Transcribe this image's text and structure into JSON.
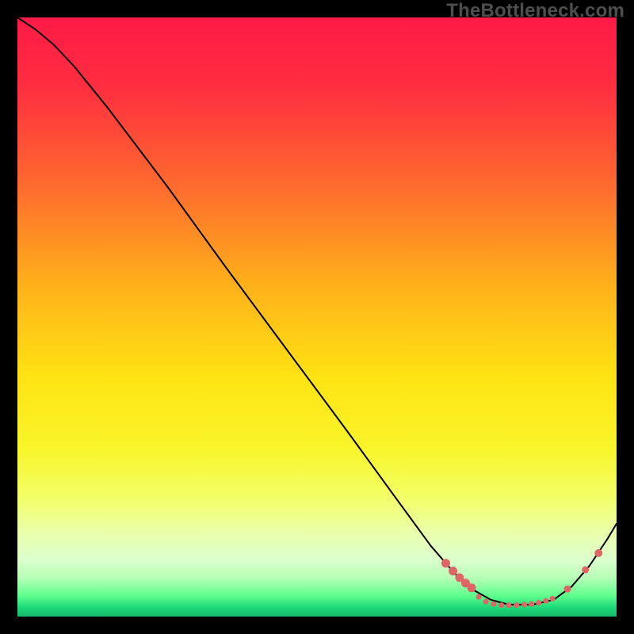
{
  "watermark": "TheBottleneck.com",
  "chart_data": {
    "type": "line",
    "title": "",
    "xlabel": "",
    "ylabel": "",
    "xlim": [
      0,
      1
    ],
    "ylim": [
      0,
      1
    ],
    "gradient_stops": [
      {
        "offset": 0.0,
        "color": "#ff1a47"
      },
      {
        "offset": 0.12,
        "color": "#ff2f40"
      },
      {
        "offset": 0.28,
        "color": "#ff6a2e"
      },
      {
        "offset": 0.45,
        "color": "#ffb21a"
      },
      {
        "offset": 0.6,
        "color": "#ffe313"
      },
      {
        "offset": 0.72,
        "color": "#f8f52a"
      },
      {
        "offset": 0.8,
        "color": "#f3ff66"
      },
      {
        "offset": 0.86,
        "color": "#eaffab"
      },
      {
        "offset": 0.905,
        "color": "#dcffce"
      },
      {
        "offset": 0.935,
        "color": "#b7ffb7"
      },
      {
        "offset": 0.965,
        "color": "#5fff8d"
      },
      {
        "offset": 0.985,
        "color": "#1dd97a"
      },
      {
        "offset": 1.0,
        "color": "#16b96b"
      }
    ],
    "series": [
      {
        "name": "curve",
        "stroke": "#000000",
        "stroke_width": 2,
        "points": [
          {
            "x": 0.0,
            "y": 1.0
          },
          {
            "x": 0.03,
            "y": 0.98
          },
          {
            "x": 0.06,
            "y": 0.955
          },
          {
            "x": 0.095,
            "y": 0.918
          },
          {
            "x": 0.15,
            "y": 0.85
          },
          {
            "x": 0.25,
            "y": 0.718
          },
          {
            "x": 0.35,
            "y": 0.58
          },
          {
            "x": 0.45,
            "y": 0.445
          },
          {
            "x": 0.55,
            "y": 0.31
          },
          {
            "x": 0.63,
            "y": 0.2
          },
          {
            "x": 0.69,
            "y": 0.118
          },
          {
            "x": 0.73,
            "y": 0.072
          },
          {
            "x": 0.76,
            "y": 0.045
          },
          {
            "x": 0.79,
            "y": 0.028
          },
          {
            "x": 0.82,
            "y": 0.02
          },
          {
            "x": 0.86,
            "y": 0.02
          },
          {
            "x": 0.895,
            "y": 0.028
          },
          {
            "x": 0.925,
            "y": 0.05
          },
          {
            "x": 0.955,
            "y": 0.085
          },
          {
            "x": 0.985,
            "y": 0.13
          },
          {
            "x": 1.0,
            "y": 0.155
          }
        ]
      }
    ],
    "markers": {
      "name": "highlight-dots",
      "fill": "#e06666",
      "r_small": 3.5,
      "r_large": 5.5,
      "points": [
        {
          "x": 0.715,
          "y": 0.089,
          "r": 5.5
        },
        {
          "x": 0.727,
          "y": 0.076,
          "r": 5.5
        },
        {
          "x": 0.738,
          "y": 0.065,
          "r": 5.5
        },
        {
          "x": 0.748,
          "y": 0.056,
          "r": 5.5
        },
        {
          "x": 0.758,
          "y": 0.048,
          "r": 5.5
        },
        {
          "x": 0.77,
          "y": 0.033,
          "r": 3.5
        },
        {
          "x": 0.782,
          "y": 0.025,
          "r": 3.5
        },
        {
          "x": 0.795,
          "y": 0.021,
          "r": 3.5
        },
        {
          "x": 0.808,
          "y": 0.019,
          "r": 3.5
        },
        {
          "x": 0.82,
          "y": 0.019,
          "r": 3.5
        },
        {
          "x": 0.833,
          "y": 0.019,
          "r": 3.5
        },
        {
          "x": 0.846,
          "y": 0.02,
          "r": 3.5
        },
        {
          "x": 0.858,
          "y": 0.021,
          "r": 3.5
        },
        {
          "x": 0.87,
          "y": 0.023,
          "r": 3.5
        },
        {
          "x": 0.882,
          "y": 0.026,
          "r": 3.5
        },
        {
          "x": 0.893,
          "y": 0.03,
          "r": 3.5
        },
        {
          "x": 0.918,
          "y": 0.046,
          "r": 4.5
        },
        {
          "x": 0.948,
          "y": 0.078,
          "r": 4.5
        },
        {
          "x": 0.97,
          "y": 0.106,
          "r": 5.0
        }
      ]
    }
  }
}
